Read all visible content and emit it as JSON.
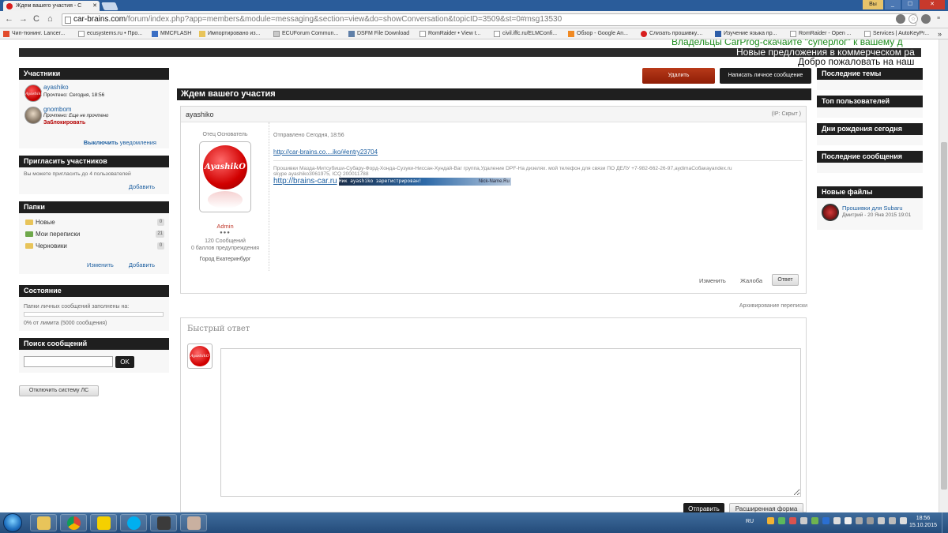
{
  "browser": {
    "tab_title": "Ждем вашего участия - С",
    "tab_close": "✕",
    "user_label": "Вы",
    "window_min": "_",
    "window_max": "☐",
    "window_close": "✕",
    "url_domain": "car-brains.com",
    "url_rest": "/forum/index.php?app=members&module=messaging&section=view&do=showConversation&topicID=3509&st=0#msg13530",
    "bookmarks": [
      "Чип-тюнинг. Lancer...",
      "ecusystems.ru • Про...",
      "MMCFLASH",
      "Импортировано из...",
      "ECUForum Commun...",
      "DSFM File Download",
      "RomRaider • View t...",
      "civil.iffc.ru/ELMConfi...",
      "Обзор - Google An...",
      "Слизать прошивку....",
      "Изучение языка пр...",
      "RomRaider - Open ...",
      "Services | AutoKeyPr..."
    ],
    "bookmarks_more": "»"
  },
  "ticker": {
    "line1": "Владельцы CarProg-скачайте \"суперлог\" к вашему д",
    "line2": "Новые предложения в коммерческом ра",
    "line3": "Добро пожаловать на наш"
  },
  "left": {
    "participants_title": "Участники",
    "participants": [
      {
        "name": "ayashiko",
        "status": "Прочтено: Сегодня, 18:56",
        "avatar_text": "AyashikO"
      },
      {
        "name": "gnombom",
        "status": "Прочтено: Еще не прочтено",
        "action": "Заблокировать"
      }
    ],
    "notify_bold": "Выключить",
    "notify_rest": " уведомления",
    "invite_title": "Пригласить участников",
    "invite_text": "Вы можете пригласить до 4 пользователей",
    "invite_add": "Добавить",
    "folders_title": "Папки",
    "folders": [
      {
        "name": "Новые",
        "count": "0"
      },
      {
        "name": "Мои переписки",
        "count": "21"
      },
      {
        "name": "Черновики",
        "count": "0"
      }
    ],
    "folders_edit": "Изменить",
    "folders_add": "Добавить",
    "state_title": "Состояние",
    "state_text": "Папки личных сообщений заполнены на:",
    "state_percent": "0% от лимита (5000 сообщения)",
    "state_fill": 0,
    "search_title": "Поиск сообщений",
    "search_value": "",
    "search_ok": "OK",
    "disable_pm": "Отключить систему ЛС"
  },
  "main": {
    "delete_btn": "Удалить",
    "write_pm_btn": "Написать личное сообщение",
    "title": "Ждем вашего участия",
    "post": {
      "author": "ayashiko",
      "ip": "(IP: Скрыт )",
      "author_title": "Отец Основатель",
      "avatar_text": "AyashikO",
      "group": "Admin",
      "pips": "●●●",
      "posts": "120 Сообщений",
      "warnings": "0 баллов предупреждения",
      "city": "Город Екатеринбург",
      "sent": "Отправлено Сегодня, 18:56",
      "link": "http://car-brains.co....iko/#entry23704",
      "sig1": "Прошивки Мазда-Митсубиши-Субару-Форд-Хонда-Сузуки-Ниссан-Хундай-Ваг группа,Удаление DPF-На дизелях. мой телефон для связи ПО ДЕЛУ +7-982-662-26-97,aydimaСобакаyandex.ru",
      "sig2": "skype ayashiko3061975, ICQ 200011788",
      "sig_link": "http://brains-car.ru",
      "banner_text": "Ник ayashiko зарегистрирован!",
      "banner_site": "Nick-Name.Ru",
      "edit": "Изменить",
      "report": "Жалоба",
      "reply": "Ответ"
    },
    "archive": "Архивирование переписки",
    "quick_title": "Быстрый ответ",
    "quick_avatar": "AyashikO",
    "quick_text": "",
    "send_btn": "Отправить",
    "advanced_btn": "Расширенная форма"
  },
  "right": {
    "latest_topics": "Последние темы",
    "top_users": "Топ пользователей",
    "birthdays": "Дни рождения сегодня",
    "latest_posts": "Последние сообщения",
    "new_files": "Новые файлы",
    "file_name": "Прошивки для Subaru",
    "file_meta": "Дмитрий - 20 Янв 2015 19:01"
  },
  "taskbar": {
    "lang": "RU",
    "time": "18:56",
    "date": "15.10.2015"
  },
  "colors": {
    "accent_dark": "#1f1f1f",
    "delete_red": "#9e2a0d",
    "link_blue": "#1d5fa0",
    "ticker_green": "#1b8a1b"
  }
}
